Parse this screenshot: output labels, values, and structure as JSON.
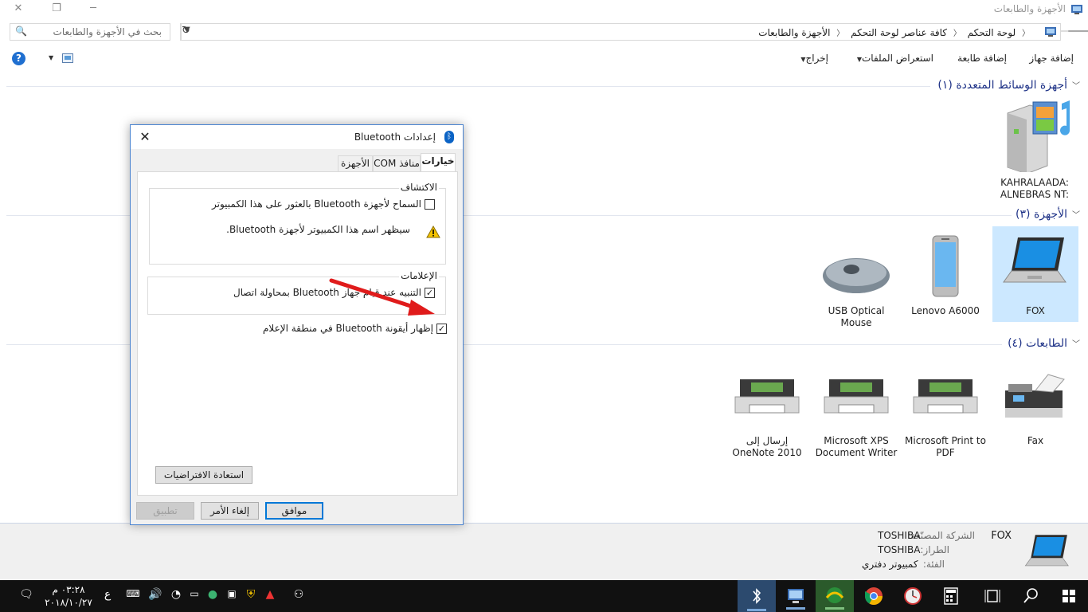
{
  "window": {
    "title": "الأجهزة والطابعات",
    "controls": {
      "close": "✕",
      "restore": "❐",
      "minimize": "─"
    }
  },
  "address": {
    "crumbs": [
      "لوحة التحكم",
      "كافة عناصر لوحة التحكم",
      "الأجهزة والطابعات"
    ],
    "search_placeholder": "بحث في الأجهزة والطابعات"
  },
  "commands": {
    "add_device": "إضافة جهاز",
    "add_printer": "إضافة طابعة",
    "browse_files": "استعراض الملفات",
    "eject": "إخراج"
  },
  "groups": {
    "multimedia": "أجهزة الوسائط المتعددة (١)",
    "devices": "الأجهزة (٣)",
    "printers": "الطابعات (٤)"
  },
  "multimedia_devices": [
    {
      "name": "KAHRALAADA: ALNEBRAS NT:",
      "icon": "media-server-icon"
    }
  ],
  "devices": [
    {
      "name": "FOX",
      "icon": "laptop-icon",
      "selected": true
    },
    {
      "name": "Lenovo A6000",
      "icon": "phone-icon"
    },
    {
      "name": "USB Optical Mouse",
      "icon": "mouse-icon"
    }
  ],
  "printers": [
    {
      "name": "Fax",
      "icon": "fax-icon"
    },
    {
      "name": "Microsoft Print to PDF",
      "icon": "printer-icon"
    },
    {
      "name": "Microsoft XPS Document Writer",
      "icon": "printer-icon"
    },
    {
      "name": "إرسال إلى OneNote 2010",
      "icon": "printer-icon"
    }
  ],
  "details": {
    "name": "FOX",
    "manufacturer_label": "الشركة المصنّعة:",
    "manufacturer": "TOSHIBA",
    "model_label": "الطراز:",
    "model": "TOSHIBA",
    "category_label": "الفئة:",
    "category": "كمبيوتر دفتري"
  },
  "dialog": {
    "title": "إعدادات Bluetooth",
    "tabs": [
      "خيارات",
      "منافذ COM",
      "الأجهزة"
    ],
    "discovery_legend": "الاكتشاف",
    "allow_discovery": "السماح لأجهزة Bluetooth بالعثور على هذا الكمبيوتر",
    "allow_discovery_checked": false,
    "warning_text": "سيظهر اسم هذا الكمبيوتر لأجهزة Bluetooth.",
    "notifications_legend": "الإعلامات",
    "alert_connect": "التنبيه عند قيام جهاز Bluetooth بمحاولة اتصال",
    "alert_connect_checked": true,
    "show_icon": "إظهار أيقونة Bluetooth في منطقة الإعلام",
    "show_icon_checked": true,
    "restore_defaults": "استعادة الافتراضيات",
    "ok": "موافق",
    "cancel": "إلغاء الأمر",
    "apply": "تطبيق"
  },
  "taskbar": {
    "time": "٠٣:٢٨ م",
    "date": "٢٠١٨/١٠/٢٧",
    "language": "ع"
  },
  "colors": {
    "accent": "#0078d7",
    "annotation_arrow": "#e01b1b",
    "group_header": "#1e3287",
    "selected_bg": "#cce8ff"
  }
}
